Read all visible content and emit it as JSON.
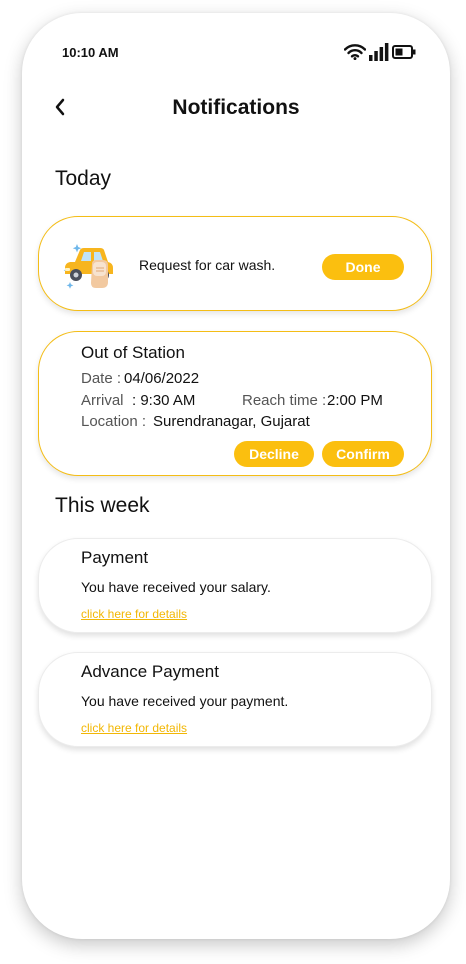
{
  "status_bar": {
    "time": "10:10 AM"
  },
  "header": {
    "title": "Notifications"
  },
  "sections": {
    "today": "Today",
    "this_week": "This week"
  },
  "car_wash_card": {
    "message": "Request for car wash.",
    "button": "Done"
  },
  "station_card": {
    "title": "Out of Station",
    "date_label": "Date :",
    "date_value": "04/06/2022",
    "arrival_label": "Arrival",
    "arrival_value": ": 9:30 AM",
    "reach_label": "Reach time :",
    "reach_value": "2:00 PM",
    "location_label": "Location :",
    "location_value": "Surendranagar, Gujarat",
    "decline_button": "Decline",
    "confirm_button": "Confirm"
  },
  "payment_card": {
    "title": "Payment",
    "message": "You have received your salary.",
    "link": "click here for details"
  },
  "advance_card": {
    "title": "Advance Payment",
    "message": "You have received your payment.",
    "link": "click here for details"
  },
  "colors": {
    "accent": "#fbbf0f",
    "card_border": "#f4bd16"
  },
  "icons": [
    "wifi-icon",
    "signal-icon",
    "battery-icon",
    "back-arrow-icon",
    "car-wash-icon"
  ]
}
